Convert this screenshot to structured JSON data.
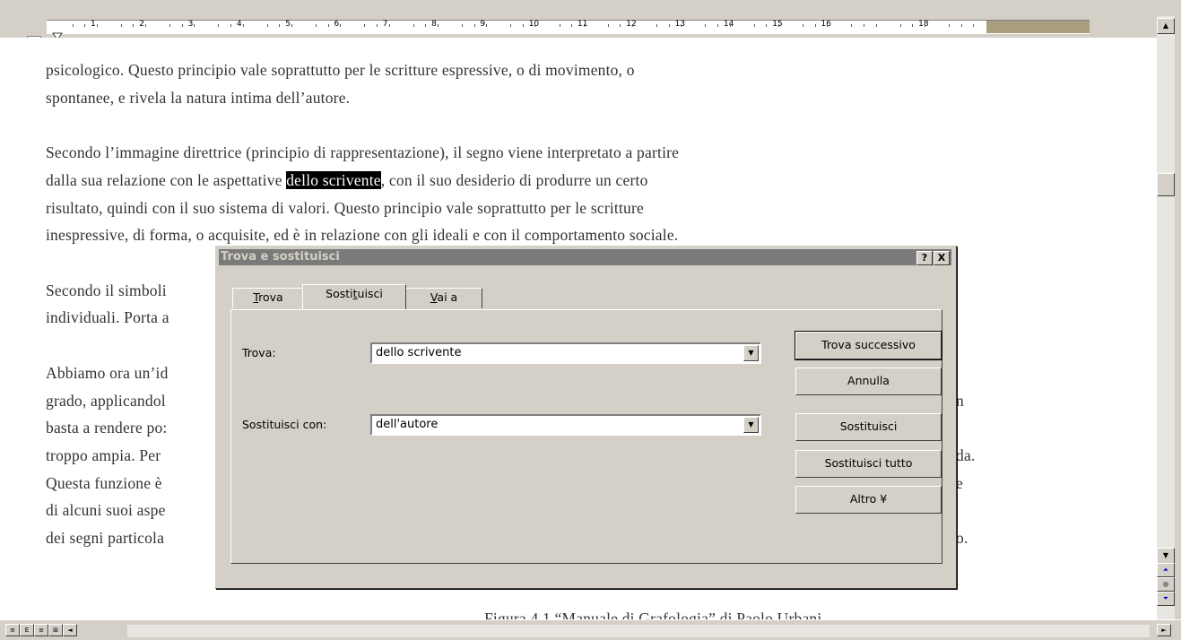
{
  "ruler": {
    "tab_selector": "L",
    "numbers": [
      "1",
      "2",
      "3",
      "4",
      "5",
      "6",
      "7",
      "8",
      "9",
      "10",
      "11",
      "12",
      "13",
      "14",
      "15",
      "16",
      "18"
    ]
  },
  "document": {
    "lines": [
      "psicologico. Questo principio vale soprattutto per le scritture espressive, o di movimento, o",
      "spontanee, e rivela la natura intima dell’autore.",
      "Secondo l’immagine direttrice (principio di rappresentazione), il segno viene interpretato a partire",
      "risultato, quindi con il suo sistema di valori.  Questo principio vale soprattutto per le scritture",
      "inespressive, di forma, o acquisite, ed è in relazione con gli ideali e con il comportamento sociale.",
      "Secondo il simboli",
      "individuali. Porta a",
      "Abbiamo ora un’id",
      "grado, applicandol",
      "basta a rendere po:",
      "troppo ampia. Per",
      "Questa funzione è",
      "di alcuni suoi aspe",
      "dei segni particola"
    ],
    "selected_line": {
      "before": "dalla sua relazione con le aspettative ",
      "selected": "dello scrivente",
      "after": ", con il suo desiderio di produrre un certo"
    },
    "right_fragments": [
      "n",
      "da.",
      "e",
      "o."
    ],
    "bottom_partial": "Figura 4.1 “Manuale di Grafologia” di Paolo Urbani"
  },
  "dialog": {
    "title": "Trova e sostituisci",
    "help_btn": "?",
    "close_btn": "X",
    "tabs": [
      {
        "label": "Trova",
        "underline_index": 0
      },
      {
        "label": "Sostituisci",
        "underline_index": 5
      },
      {
        "label": "Vai a",
        "underline_index": 0
      }
    ],
    "find_label": "Trova:",
    "find_value": "dello scrivente",
    "replace_label": "Sostituisci con:",
    "replace_value": "dell'autore",
    "buttons": {
      "find_next": "Trova successivo",
      "cancel": "Annulla",
      "replace": "Sostituisci",
      "replace_all": "Sostituisci tutto",
      "more": "Altro ¥"
    }
  },
  "scrollbar": {
    "up": "▲",
    "down": "▼",
    "prev_page": "⏶",
    "select_browse": "●",
    "next_page": "⏷"
  },
  "view_buttons": [
    "≡",
    "E",
    "≡",
    "⊞",
    "◄"
  ],
  "hscroll_right": "►"
}
